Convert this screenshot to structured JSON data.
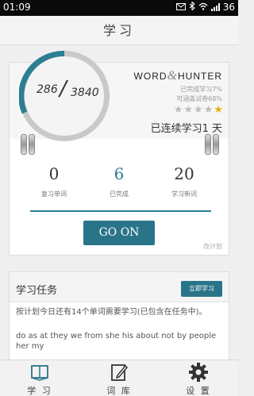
{
  "status_bar": {
    "time": "01:09",
    "battery": "36"
  },
  "header": {
    "title": "学习"
  },
  "progress": {
    "learned": "286",
    "separator": "/",
    "total": "3840"
  },
  "brand": {
    "logo_part1": "WORD",
    "logo_amp": "&",
    "logo_part2": "HUNTER"
  },
  "stats": {
    "completed": "已完成学习7%",
    "coverage": "可涵盖试卷68%",
    "stars_total": 5,
    "stars_on": 1,
    "streak": "已连续学习1 天"
  },
  "counts": [
    {
      "value": "0",
      "label": "复习单词"
    },
    {
      "value": "6",
      "label": "已完成"
    },
    {
      "value": "20",
      "label": "学习新词"
    }
  ],
  "go_button": "GO ON",
  "change_plan": "改计划",
  "task": {
    "title": "学习任务",
    "button": "立即学习",
    "description": "按计划今日还有14个单词需要学习(已包含在任务中)。",
    "words": "do as at they we from she his about not by people her my"
  },
  "tabs": [
    {
      "label": "学 习",
      "icon": "book-icon"
    },
    {
      "label": "词 库",
      "icon": "notebook-edit-icon"
    },
    {
      "label": "设 置",
      "icon": "gear-icon"
    }
  ],
  "colors": {
    "accent": "#2a7489",
    "star": "#e6b400"
  }
}
